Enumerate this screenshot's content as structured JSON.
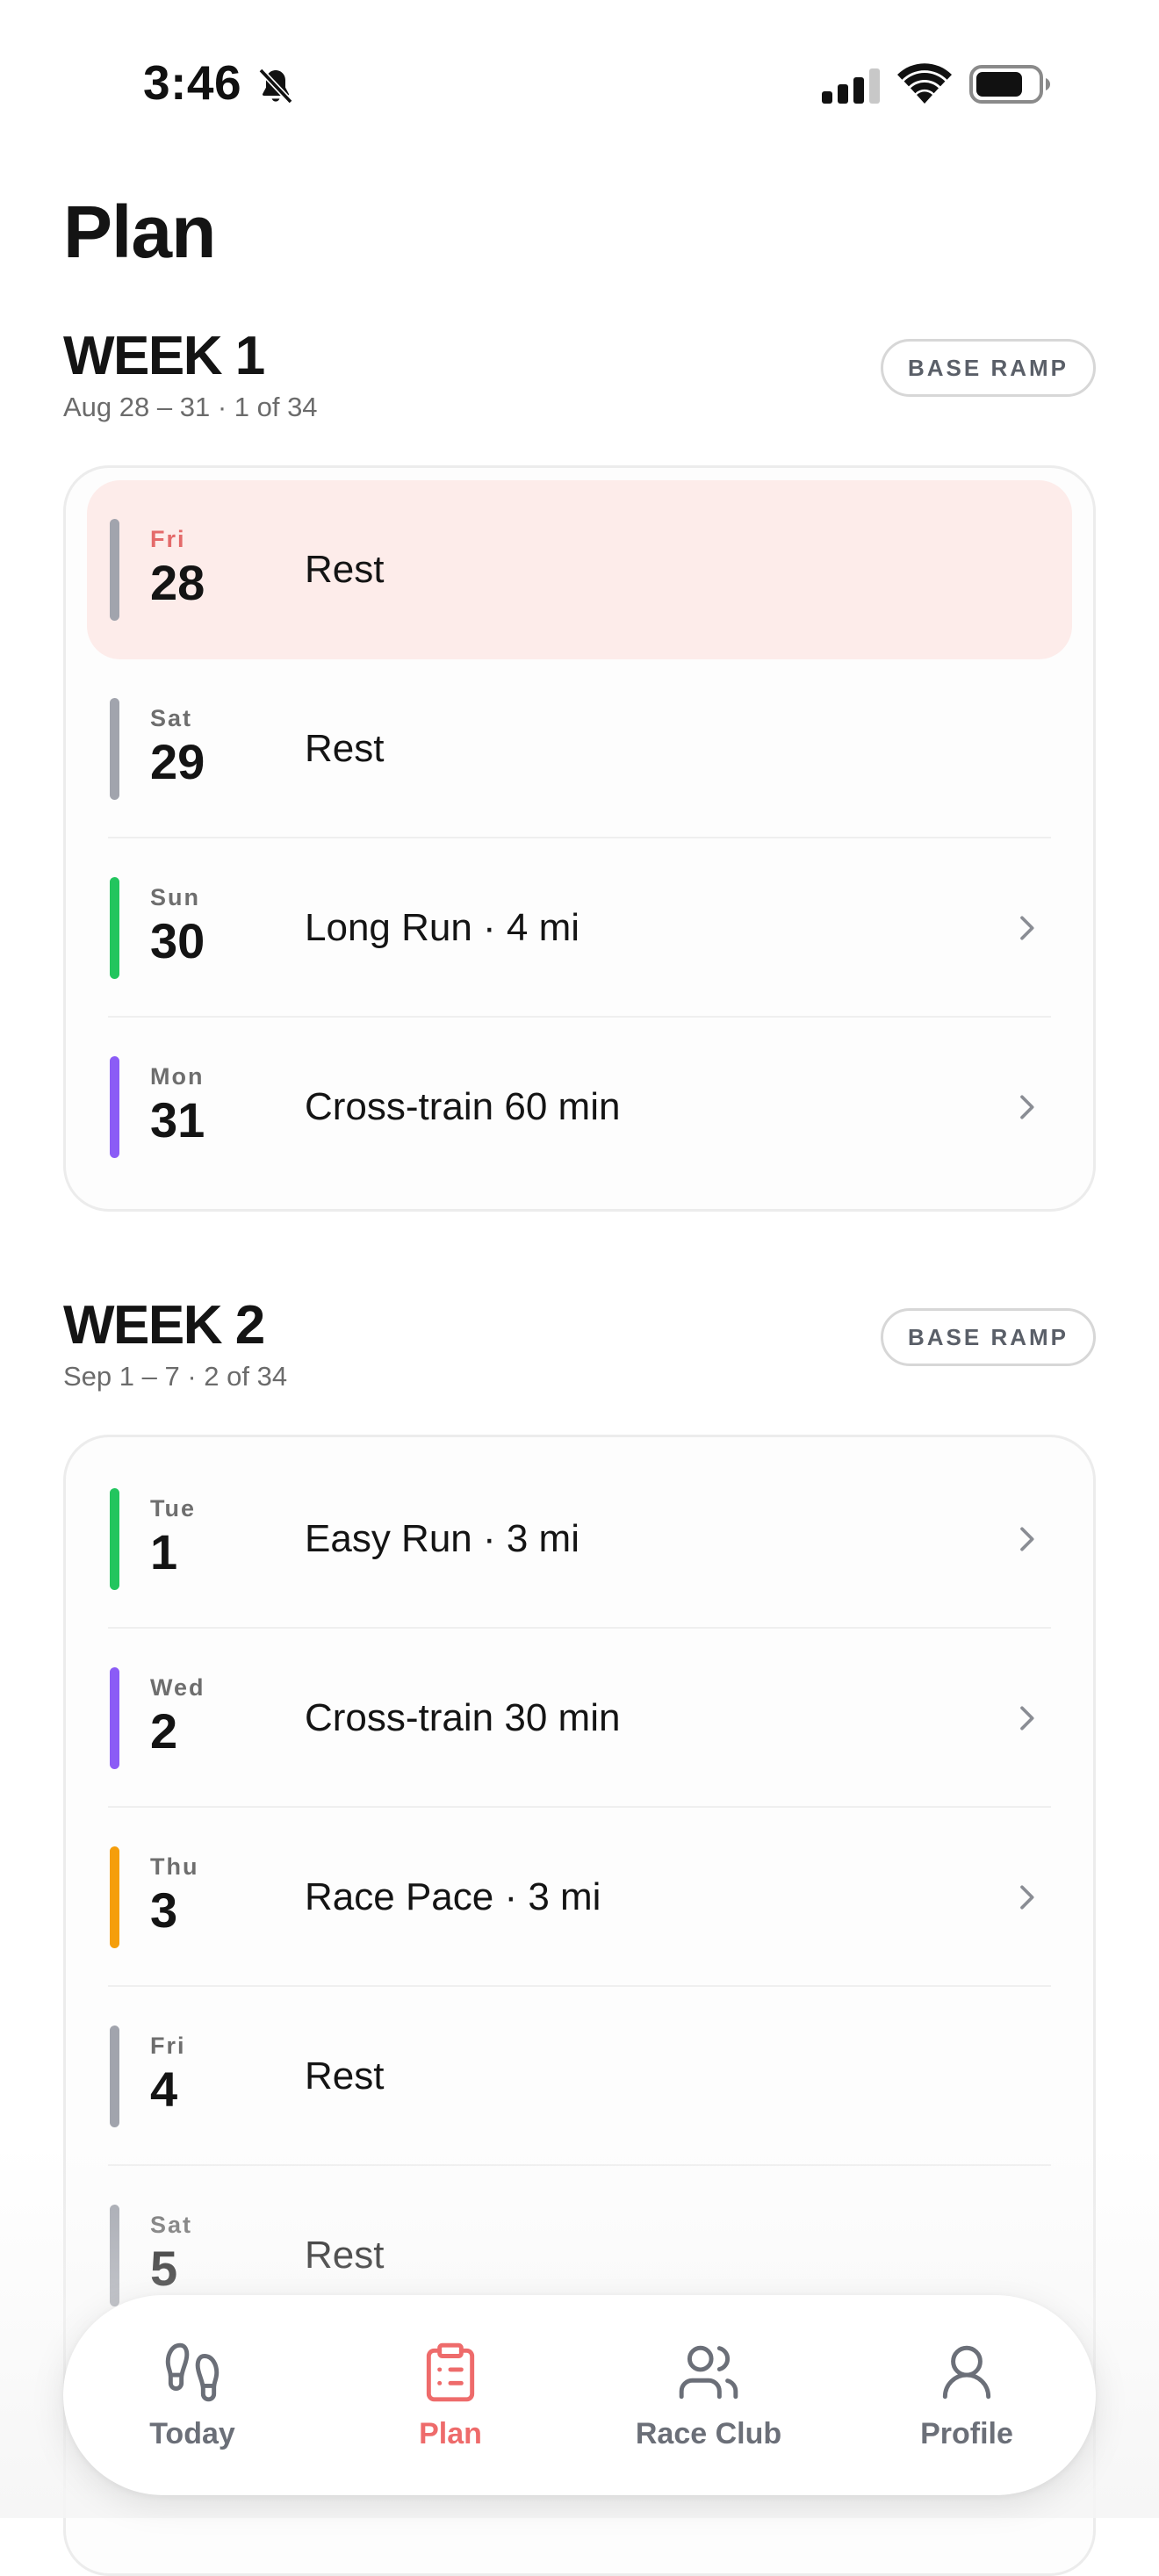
{
  "status": {
    "time": "3:46"
  },
  "page": {
    "title": "Plan"
  },
  "colors": {
    "rest": "#a1a4ad",
    "run": "#22c55e",
    "cross": "#8b5cf6",
    "race": "#f59e0b",
    "accent": "#ee6b6b",
    "today_bg": "#fdecea"
  },
  "weeks": [
    {
      "title": "WEEK 1",
      "sub": "Aug 28 – 31 · 1 of 34",
      "phase": "BASE RAMP",
      "days": [
        {
          "dow": "Fri",
          "num": "28",
          "label": "Rest",
          "type": "rest",
          "today": true,
          "chevron": false
        },
        {
          "dow": "Sat",
          "num": "29",
          "label": "Rest",
          "type": "rest",
          "chevron": false
        },
        {
          "dow": "Sun",
          "num": "30",
          "label": "Long Run · 4 mi",
          "type": "run",
          "chevron": true
        },
        {
          "dow": "Mon",
          "num": "31",
          "label": "Cross-train 60 min",
          "type": "cross",
          "chevron": true
        }
      ]
    },
    {
      "title": "WEEK 2",
      "sub": "Sep 1 – 7 · 2 of 34",
      "phase": "BASE RAMP",
      "days": [
        {
          "dow": "Tue",
          "num": "1",
          "label": "Easy Run · 3 mi",
          "type": "run",
          "chevron": true
        },
        {
          "dow": "Wed",
          "num": "2",
          "label": "Cross-train 30 min",
          "type": "cross",
          "chevron": true
        },
        {
          "dow": "Thu",
          "num": "3",
          "label": "Race Pace · 3 mi",
          "type": "race",
          "chevron": true
        },
        {
          "dow": "Fri",
          "num": "4",
          "label": "Rest",
          "type": "rest",
          "chevron": false
        },
        {
          "dow": "Sat",
          "num": "5",
          "label": "Rest",
          "type": "rest",
          "chevron": false
        }
      ]
    }
  ],
  "tabs": [
    {
      "label": "Today",
      "icon": "footprints-icon",
      "active": false
    },
    {
      "label": "Plan",
      "icon": "clipboard-list-icon",
      "active": true
    },
    {
      "label": "Race Club",
      "icon": "users-icon",
      "active": false
    },
    {
      "label": "Profile",
      "icon": "user-icon",
      "active": false
    }
  ]
}
